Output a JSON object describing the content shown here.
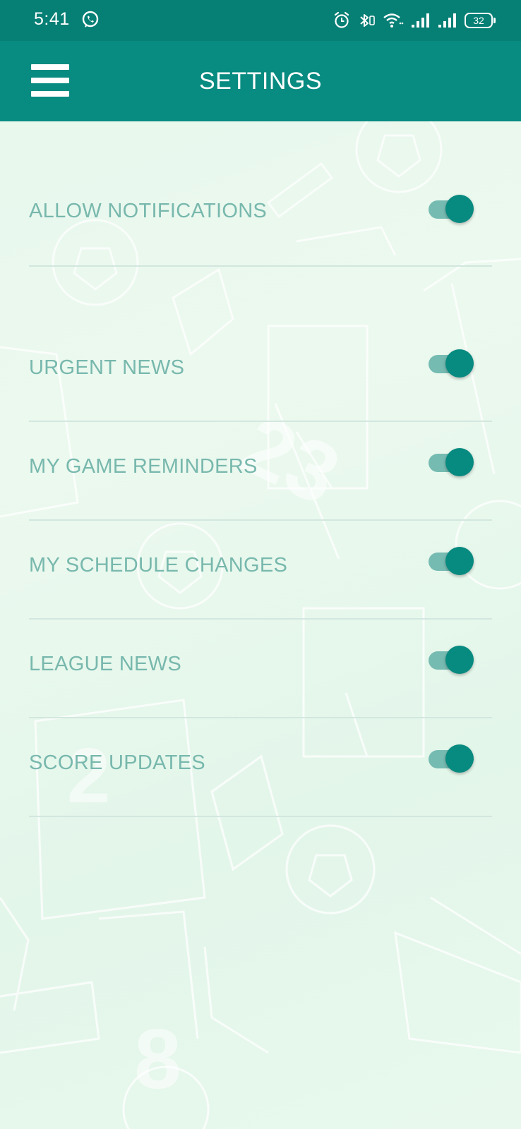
{
  "status_bar": {
    "time": "5:41",
    "battery_level": "32",
    "icons": [
      "whatsapp-icon",
      "alarm-icon",
      "bluetooth-icon",
      "wifi-icon",
      "signal-icon",
      "signal-icon",
      "battery-icon"
    ]
  },
  "app_bar": {
    "title": "SETTINGS",
    "menu_icon": "hamburger-menu-icon"
  },
  "colors": {
    "status_bar": "#067f75",
    "app_bar": "#088b81",
    "label": "#78b8ad",
    "toggle_on_thumb": "#078a80",
    "toggle_on_track": "#76bbb2",
    "divider": "#d2e7df",
    "background": "#e6f7ec"
  },
  "settings": [
    {
      "label": "ALLOW NOTIFICATIONS",
      "enabled": true
    },
    {
      "label": "URGENT NEWS",
      "enabled": true
    },
    {
      "label": "MY GAME REMINDERS",
      "enabled": true
    },
    {
      "label": "MY SCHEDULE CHANGES",
      "enabled": true
    },
    {
      "label": "LEAGUE NEWS",
      "enabled": true
    },
    {
      "label": "SCORE UPDATES",
      "enabled": true
    }
  ]
}
